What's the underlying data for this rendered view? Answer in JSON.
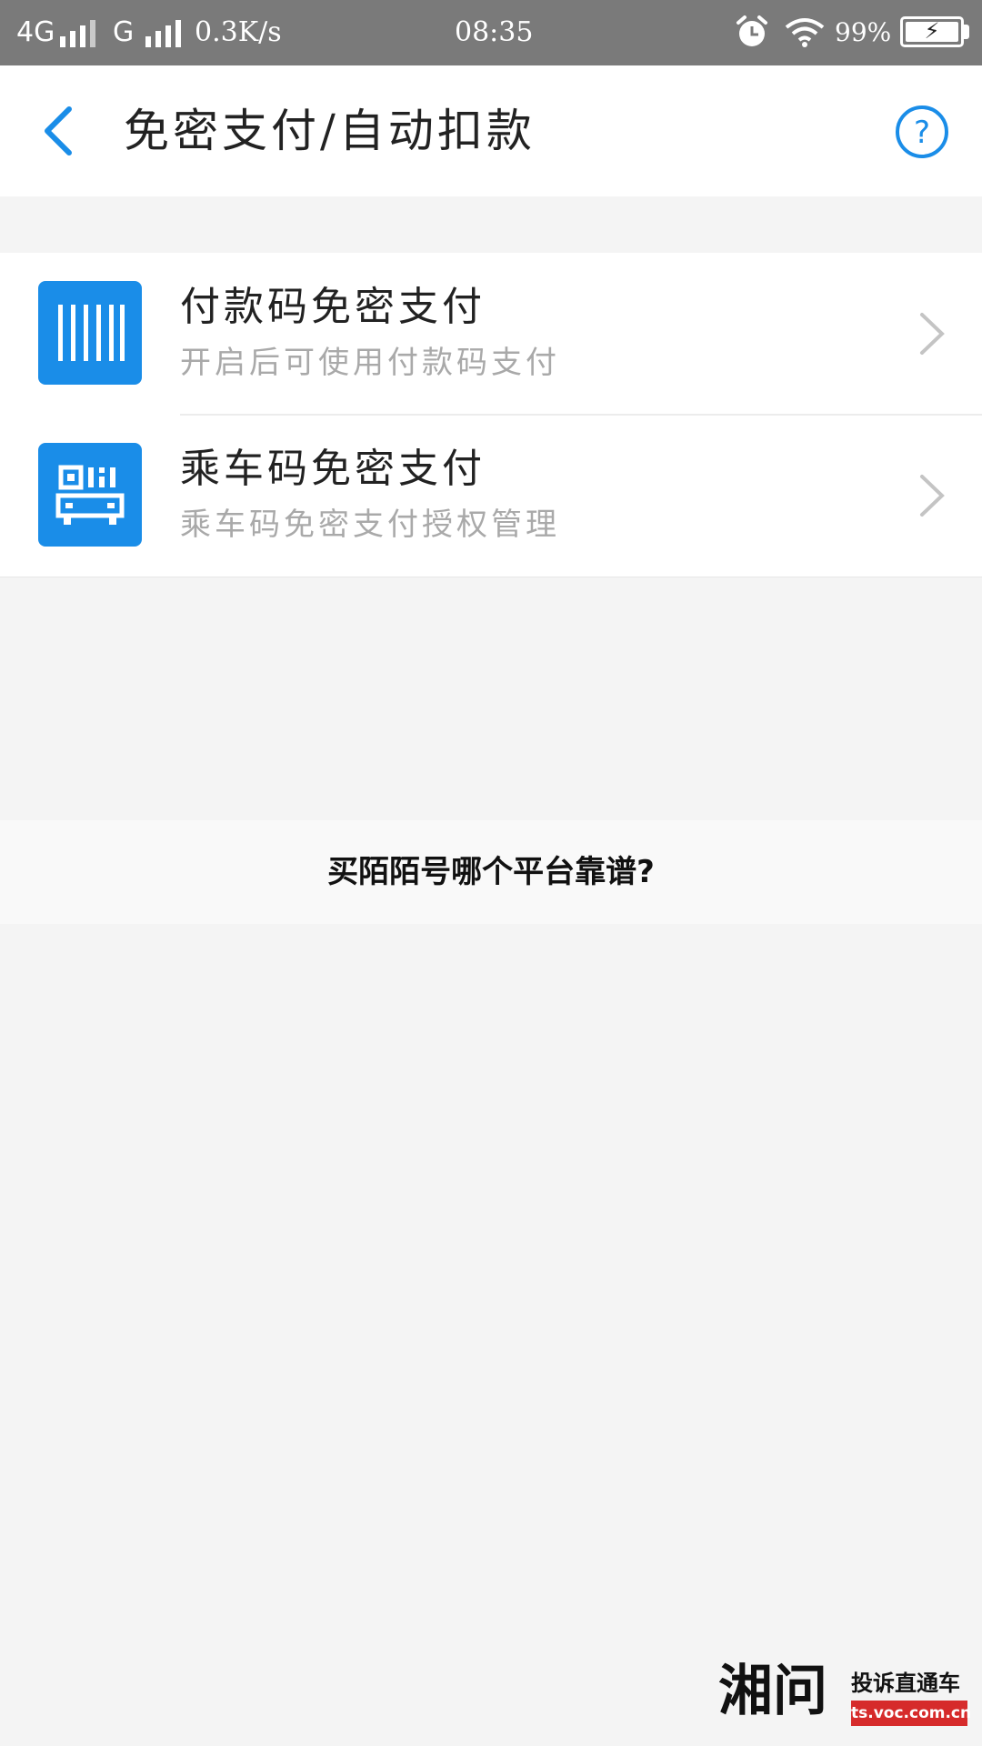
{
  "status_bar": {
    "network_1": "4G",
    "network_2": "G",
    "speed": "0.3K/s",
    "time": "08:35",
    "battery": "99%",
    "icons": [
      "signal-icon",
      "alarm-icon",
      "wifi-icon",
      "battery-charging-icon"
    ]
  },
  "header": {
    "title": "免密支付/自动扣款",
    "back_icon": "back-arrow-icon",
    "help_icon": "help-circle-icon"
  },
  "list": {
    "items": [
      {
        "title": "付款码免密支付",
        "subtitle": "开启后可使用付款码支付",
        "icon": "barcode-icon"
      },
      {
        "title": "乘车码免密支付",
        "subtitle": "乘车码免密支付授权管理",
        "icon": "bus-qr-icon"
      }
    ]
  },
  "overlay": {
    "question": "买陌陌号哪个平台靠谱?"
  },
  "watermark": {
    "logo": "湘问",
    "tagline": "投诉直通车",
    "url": "ts.voc.com.cn"
  },
  "colors": {
    "accent": "#1a8de8",
    "status_bar": "#7a7a7a",
    "background": "#f4f4f4",
    "subtitle": "#a9a9a9"
  }
}
